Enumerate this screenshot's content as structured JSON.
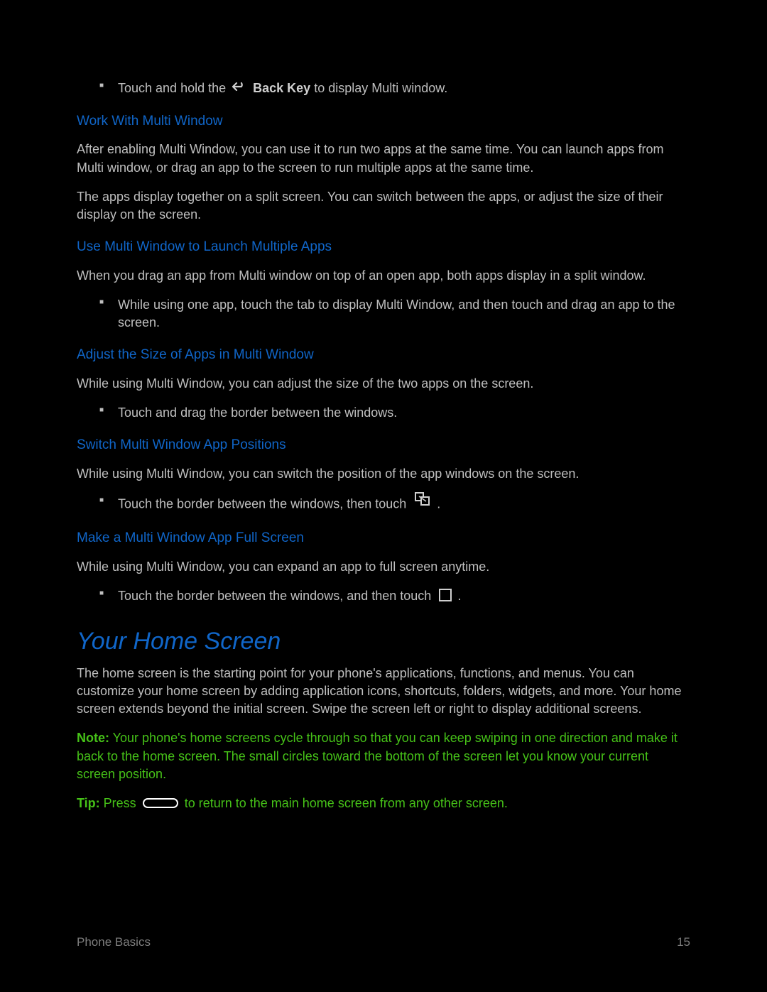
{
  "bullets": {
    "touchHold_pre": "Touch and hold the ",
    "touchHold_key": "Back Key",
    "touchHold_post": " to display Multi window.",
    "dragApp": "While using one app, touch the tab to display Multi Window, and then touch and drag an app to the screen.",
    "dragBorder": "Touch and drag the border between the windows.",
    "touchBorderSwap": "Touch the border between the windows, then touch ",
    "touchBorderFull": "Touch the border between the windows, and then touch ",
    "period": "."
  },
  "subheads": {
    "workWith": "Work With Multi Window",
    "launchMultiple": "Use Multi Window to Launch Multiple Apps",
    "adjustSize": "Adjust the Size of Apps in Multi Window",
    "switchPos": "Switch Multi Window App Positions",
    "fullScreen": "Make a Multi Window App Full Screen"
  },
  "paras": {
    "afterEnabling": "After enabling Multi Window, you can use it to run two apps at the same time. You can launch apps from Multi window, or drag an app to the screen to run multiple apps at the same time.",
    "appsDisplay": "The apps display together on a split screen. You can switch between the apps, or adjust the size of their display on the screen.",
    "whenDrag": "When you drag an app from Multi window on top of an open app, both apps display in a split window.",
    "adjustSize": "While using Multi Window, you can adjust the size of the two apps on the screen.",
    "switchPos": "While using Multi Window, you can switch the position of the app windows on the screen.",
    "expandFull": "While using Multi Window, you can expand an app to full screen anytime."
  },
  "h1": "Your Home Screen",
  "homePara": "The home screen is the starting point for your phone's applications, functions, and menus. You can customize your home screen by adding application icons, shortcuts, folders, widgets, and more. Your home screen extends beyond the initial screen. Swipe the screen left or right to display additional screens.",
  "note": {
    "label": "Note:",
    "text": " Your phone's home screens cycle through so that you can keep swiping in one direction and make it back to the home screen. The small circles toward the bottom of the screen let you know your current screen position."
  },
  "tip": {
    "label": "Tip:",
    "press": " Press ",
    "post": " to return to the main home screen from any other screen."
  },
  "footer": {
    "section": "Phone Basics",
    "page": "15"
  }
}
